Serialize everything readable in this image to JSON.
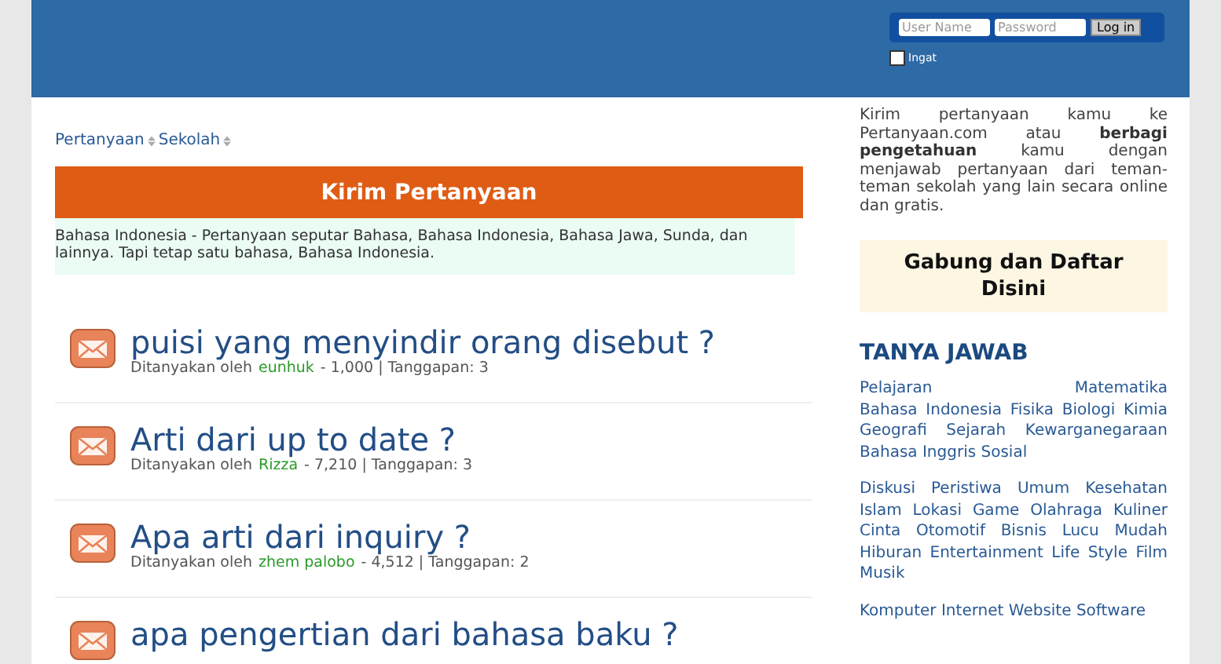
{
  "login": {
    "username_placeholder": "User Name",
    "password_placeholder": "Password",
    "button": "Log in",
    "remember": {
      "label": "Ingat",
      "checked": false
    }
  },
  "breadcrumb": [
    "Pertanyaan",
    "Sekolah"
  ],
  "banner": "Kirim Pertanyaan",
  "description": "Bahasa Indonesia - Pertanyaan seputar Bahasa, Bahasa Indonesia, Bahasa Jawa, Sunda, dan lainnya. Tapi tetap satu bahasa, Bahasa Indonesia.",
  "questions": [
    {
      "title": "puisi yang menyindir orang disebut ?",
      "asked_by": "Ditanyakan oleh",
      "user": "eunhuk",
      "stats": "- 1,000 | Tanggapan: 3"
    },
    {
      "title": "Arti dari up to date ?",
      "asked_by": "Ditanyakan oleh",
      "user": "Rizza",
      "stats": "- 7,210 | Tanggapan: 3"
    },
    {
      "title": "Apa arti dari inquiry ?",
      "asked_by": "Ditanyakan oleh",
      "user": "zhem palobo",
      "stats": "- 4,512 | Tanggapan: 2"
    },
    {
      "title": "apa pengertian dari bahasa baku ?"
    }
  ],
  "sidebar": {
    "intro": "Kirim pertanyaan kamu ke Pertanyaan.com atau **berbagi pengetahuan** kamu dengan menjawab pertanyaan dari teman-teman sekolah yang lain secara online dan gratis.",
    "join": "Gabung dan Daftar Disini",
    "heading": "TANYA JAWAB",
    "groups": [
      [
        "Pelajaran",
        "Matematika",
        "Bahasa Indonesia",
        "Fisika",
        "Biologi",
        "Kimia",
        "Geografi",
        "Sejarah",
        "Kewarganegaraan",
        "Bahasa Inggris",
        "Sosial"
      ],
      [
        "Diskusi",
        "Peristiwa",
        "Umum",
        "Kesehatan",
        "Islam",
        "Lokasi",
        "Game",
        "Olahraga",
        "Kuliner",
        "Cinta",
        "Otomotif",
        "Bisnis",
        "Lucu",
        "Mudah",
        "Hiburan",
        "Entertainment",
        "Life Style",
        "Film",
        "Musik"
      ],
      [
        "Komputer",
        "Internet",
        "Website",
        "Software"
      ]
    ]
  }
}
